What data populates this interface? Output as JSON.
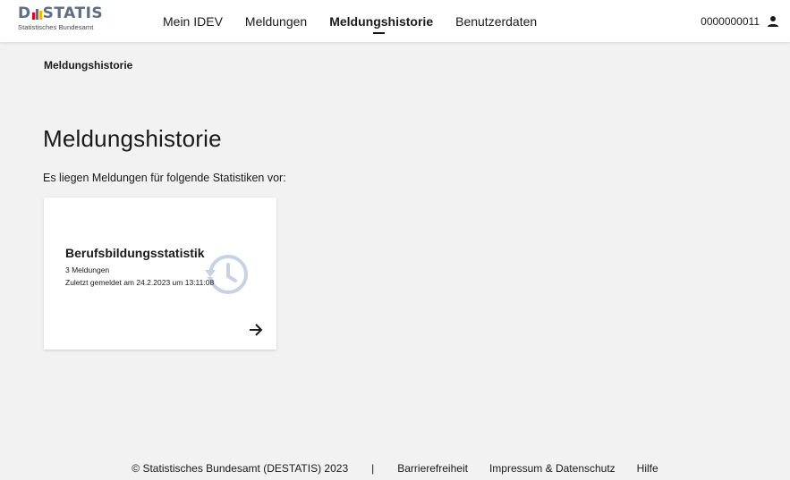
{
  "logo": {
    "wordmark_left": "D",
    "wordmark_right": "STATIS",
    "subtitle": "Statistisches Bundesamt",
    "bar_colors": [
      "#e2001a",
      "#5e6e83",
      "#f1b800"
    ]
  },
  "nav": {
    "items": [
      {
        "label": "Mein IDEV",
        "active": false
      },
      {
        "label": "Meldungen",
        "active": false
      },
      {
        "label": "Meldungshistorie",
        "active": true
      },
      {
        "label": "Benutzerdaten",
        "active": false
      }
    ]
  },
  "user": {
    "id": "0000000011",
    "icon": "user-icon"
  },
  "breadcrumb": "Meldungshistorie",
  "page": {
    "title": "Meldungshistorie",
    "intro": "Es liegen Meldungen für folgende Statistiken vor:"
  },
  "cards": [
    {
      "title": "Berufsbildungsstatistik",
      "count": "3 Meldungen",
      "last_reported": "Zuletzt gemeldet am 24.2.2023 um 13:11:08",
      "watermark_icon": "history-icon",
      "arrow_icon": "arrow-right-icon"
    }
  ],
  "footer": {
    "copyright": "© Statistisches Bundesamt (DESTATIS) 2023",
    "separator": "|",
    "links": [
      "Barrierefreiheit",
      "Impressum & Datenschutz",
      "Hilfe"
    ]
  },
  "colors": {
    "background": "#f2f2f2",
    "surface": "#ffffff",
    "text": "#1a1a1a",
    "logo_text": "#5e6e83",
    "watermark": "#c5d3e3"
  }
}
